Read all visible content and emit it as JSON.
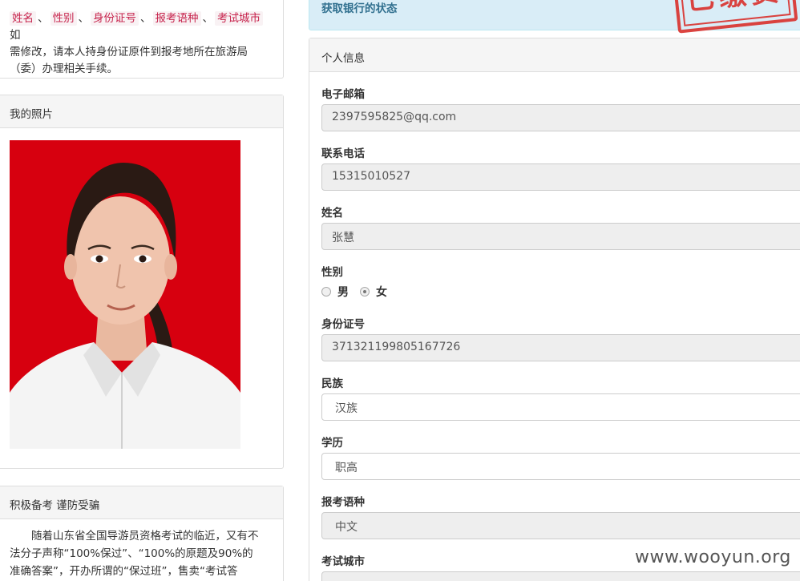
{
  "notice": {
    "tags": [
      "姓名",
      "性别",
      "身份证号",
      "报考语种",
      "考试城市"
    ],
    "separator": "、",
    "text_suffix": "如",
    "text_line2": "需修改，请本人持身份证原件到报考地所在旅游局",
    "text_line3": "（委）办理相关手续。"
  },
  "photo_card": {
    "title": "我的照片"
  },
  "fraud_card": {
    "title": "积极备考 谨防受骗",
    "body": "随着山东省全国导游员资格考试的临近，又有不法分子声称“100%保过”、“100%的原题及90%的准确答案”，开办所谓的“保过班”，售卖“考试答案”迷惑考"
  },
  "alert": {
    "text": "获取银行的状态"
  },
  "stamp": {
    "text": "已缴费"
  },
  "personal_panel": {
    "title": "个人信息",
    "email": {
      "label": "电子邮箱",
      "value": "2397595825@qq.com"
    },
    "phone": {
      "label": "联系电话",
      "value": "15315010527"
    },
    "name": {
      "label": "姓名",
      "value": "张慧"
    },
    "gender": {
      "label": "性别",
      "options": [
        "男",
        "女"
      ],
      "selected": "女"
    },
    "id_number": {
      "label": "身份证号",
      "value": "371321199805167726"
    },
    "ethnicity": {
      "label": "民族",
      "value": "汉族"
    },
    "education": {
      "label": "学历",
      "value": "职高"
    },
    "exam_language": {
      "label": "报考语种",
      "value": "中文"
    },
    "exam_city": {
      "label": "考试城市",
      "value": ""
    }
  },
  "watermark": "www.wooyun.org",
  "colors": {
    "photo_background": "#d7000f",
    "tag_text": "#c7254e",
    "alert_bg": "#d9edf7",
    "stamp": "#d9302c"
  }
}
